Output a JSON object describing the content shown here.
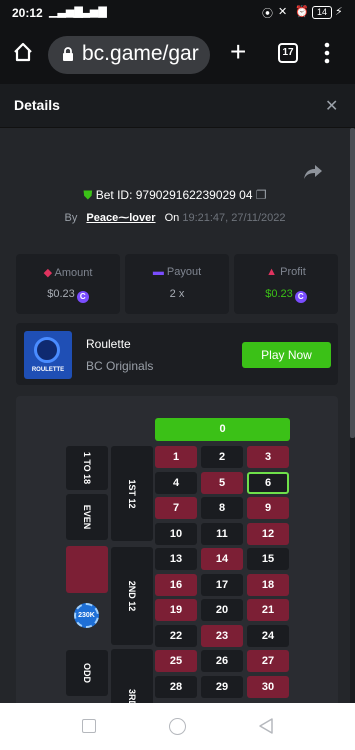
{
  "status_bar": {
    "time": "20:12",
    "dots": "···",
    "battery": "14"
  },
  "browser": {
    "url": "bc.game/gar",
    "tab_count": "17"
  },
  "details": {
    "title": "Details"
  },
  "bet": {
    "bet_id": "Bet ID: 979029162239029 04",
    "by_label": "By",
    "user": "Peace⁓lover",
    "on_label": "On",
    "datetime": "19:21:47, 27/11/2022"
  },
  "stats": {
    "amount_label": "Amount",
    "amount_value": "$0.23",
    "payout_label": "Payout",
    "payout_value": "2 x",
    "profit_label": "Profit",
    "profit_value": "$0.23"
  },
  "game": {
    "thumb_label": "ROULETTE",
    "name": "Roulette",
    "provider": "BC Originals",
    "play_label": "Play Now"
  },
  "roulette": {
    "zero": "0",
    "labels": {
      "r1to18": "1 TO 18",
      "even": "EVEN",
      "odd": "ODD",
      "d1": "1ST 12",
      "d2": "2ND 12",
      "d3": "3RD"
    },
    "chip": "230K",
    "numbers": [
      {
        "n": "1",
        "c": "red"
      },
      {
        "n": "2",
        "c": "black"
      },
      {
        "n": "3",
        "c": "red"
      },
      {
        "n": "4",
        "c": "black"
      },
      {
        "n": "5",
        "c": "red"
      },
      {
        "n": "6",
        "c": "black"
      },
      {
        "n": "7",
        "c": "red"
      },
      {
        "n": "8",
        "c": "black"
      },
      {
        "n": "9",
        "c": "red"
      },
      {
        "n": "10",
        "c": "black"
      },
      {
        "n": "11",
        "c": "black"
      },
      {
        "n": "12",
        "c": "red"
      },
      {
        "n": "13",
        "c": "black"
      },
      {
        "n": "14",
        "c": "red"
      },
      {
        "n": "15",
        "c": "black"
      },
      {
        "n": "16",
        "c": "red"
      },
      {
        "n": "17",
        "c": "black"
      },
      {
        "n": "18",
        "c": "red"
      },
      {
        "n": "19",
        "c": "red"
      },
      {
        "n": "20",
        "c": "black"
      },
      {
        "n": "21",
        "c": "red"
      },
      {
        "n": "22",
        "c": "black"
      },
      {
        "n": "23",
        "c": "red"
      },
      {
        "n": "24",
        "c": "black"
      },
      {
        "n": "25",
        "c": "red"
      },
      {
        "n": "26",
        "c": "black"
      },
      {
        "n": "27",
        "c": "red"
      },
      {
        "n": "28",
        "c": "black"
      },
      {
        "n": "29",
        "c": "black"
      },
      {
        "n": "30",
        "c": "red"
      }
    ],
    "highlighted": "6"
  },
  "colors": {
    "accent_green": "#3bc117",
    "red_cell": "#7c1f35",
    "purple": "#7a4dff",
    "profit_green": "#3bc117"
  }
}
